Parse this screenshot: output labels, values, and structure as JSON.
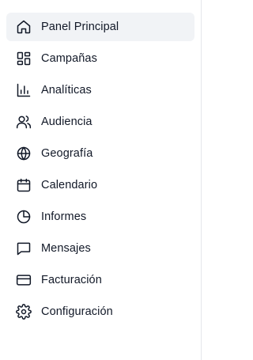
{
  "sidebar": {
    "items": [
      {
        "label": "Panel Principal",
        "icon": "home-icon",
        "active": true
      },
      {
        "label": "Campañas",
        "icon": "layout-grid-icon",
        "active": false
      },
      {
        "label": "Analíticas",
        "icon": "bar-chart-icon",
        "active": false
      },
      {
        "label": "Audiencia",
        "icon": "users-icon",
        "active": false
      },
      {
        "label": "Geografía",
        "icon": "globe-icon",
        "active": false
      },
      {
        "label": "Calendario",
        "icon": "calendar-icon",
        "active": false
      },
      {
        "label": "Informes",
        "icon": "pie-chart-icon",
        "active": false
      },
      {
        "label": "Mensajes",
        "icon": "message-square-icon",
        "active": false
      },
      {
        "label": "Facturación",
        "icon": "credit-card-icon",
        "active": false
      },
      {
        "label": "Configuración",
        "icon": "settings-icon",
        "active": false
      }
    ]
  },
  "colors": {
    "active_background": "#f1f3f6",
    "text": "#111827",
    "border": "#e5e7eb"
  }
}
